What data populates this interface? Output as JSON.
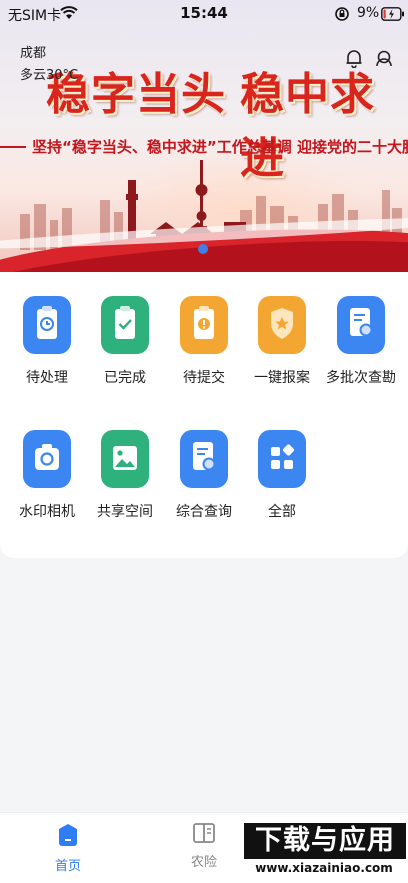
{
  "status_bar": {
    "carrier": "无SIM卡",
    "time": "15:44",
    "battery_pct": "9%"
  },
  "location": {
    "city": "成都",
    "weather": "多云30°C"
  },
  "banner": {
    "slogan_left": "稳字当头",
    "slogan_right": "稳中求进",
    "subline": "坚持“稳字当头、稳中求进”工作总基调 迎接党的二十大胜利召"
  },
  "grid": {
    "items": [
      {
        "label": "待处理",
        "icon": "clock-clipboard-icon",
        "color": "#3b86f0"
      },
      {
        "label": "已完成",
        "icon": "check-clipboard-icon",
        "color": "#2fb17d"
      },
      {
        "label": "待提交",
        "icon": "alert-clipboard-icon",
        "color": "#f3a631"
      },
      {
        "label": "一键报案",
        "icon": "star-shield-icon",
        "color": "#f3a631"
      },
      {
        "label": "多批次查勘",
        "icon": "search-document-icon",
        "color": "#3b86f0"
      },
      {
        "label": "水印相机",
        "icon": "camera-icon",
        "color": "#3b86f0"
      },
      {
        "label": "共享空间",
        "icon": "image-icon",
        "color": "#2fb17d"
      },
      {
        "label": "综合查询",
        "icon": "search-document-icon",
        "color": "#3b86f0"
      },
      {
        "label": "全部",
        "icon": "apps-grid-icon",
        "color": "#3b86f0"
      }
    ]
  },
  "tabbar": {
    "tabs": [
      {
        "label": "首页",
        "icon": "home-icon",
        "active": true
      },
      {
        "label": "农险",
        "icon": "book-icon",
        "active": false
      },
      {
        "label": "",
        "icon": "user-icon",
        "active": false
      }
    ]
  },
  "watermark": {
    "title": "下载与应用",
    "url": "www.xiazainiao.com"
  },
  "colors": {
    "accent": "#2f7cf6",
    "banner_red": "#d9251d"
  }
}
